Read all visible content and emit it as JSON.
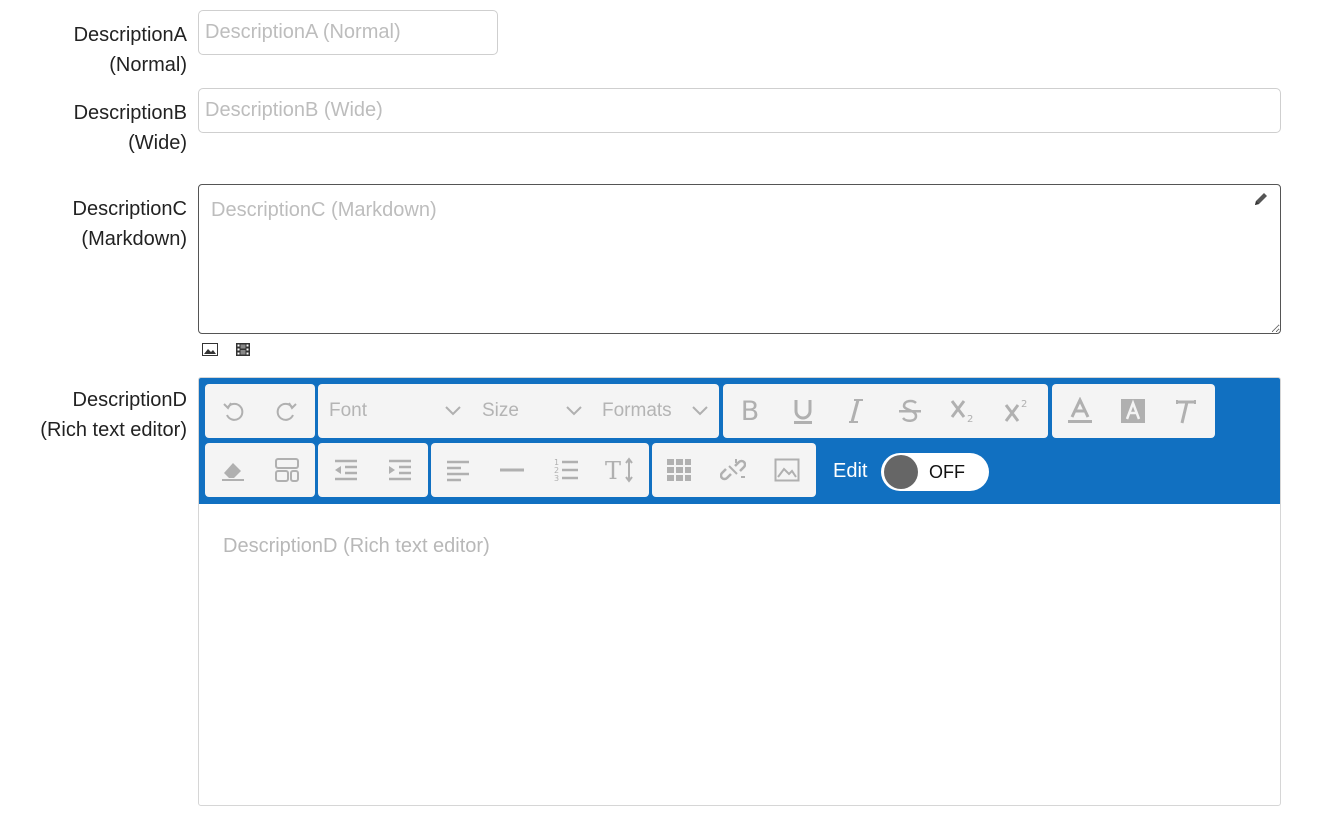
{
  "fields": {
    "a": {
      "label_line1": "DescriptionA",
      "label_line2": "(Normal)",
      "placeholder": "DescriptionA (Normal)"
    },
    "b": {
      "label_line1": "DescriptionB",
      "label_line2": "(Wide)",
      "placeholder": "DescriptionB (Wide)"
    },
    "c": {
      "label_line1": "DescriptionC",
      "label_line2": "(Markdown)",
      "placeholder": "DescriptionC (Markdown)"
    },
    "d": {
      "label_line1": "DescriptionD",
      "label_line2": "(Rich text editor)",
      "placeholder": "DescriptionD (Rich text editor)"
    }
  },
  "toolbar": {
    "font_label": "Font",
    "size_label": "Size",
    "formats_label": "Formats",
    "edit_label": "Edit",
    "toggle_state": "OFF",
    "accent_color": "#1170c1"
  }
}
